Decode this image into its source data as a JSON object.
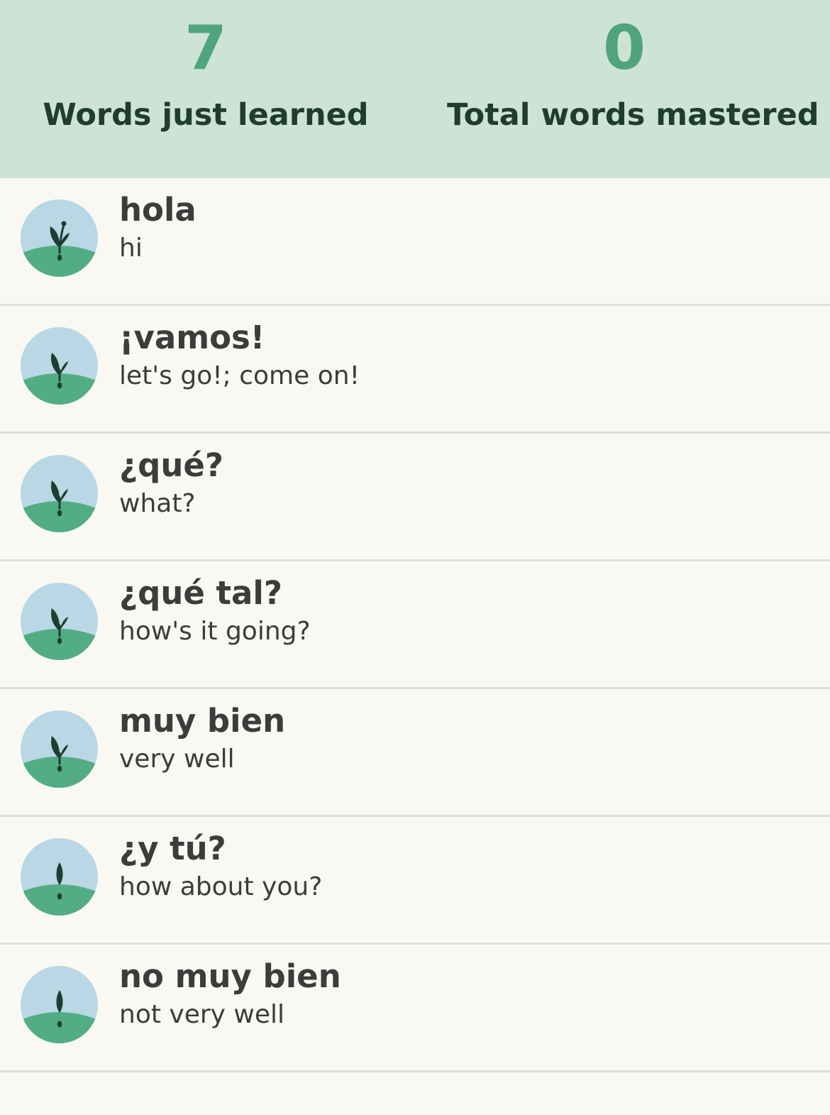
{
  "stats": {
    "learned": {
      "value": "7",
      "label": "Words just learned"
    },
    "mastered": {
      "value": "0",
      "label": "Total words mastered"
    }
  },
  "colors": {
    "header_bg": "#cde3d6",
    "accent_green": "#4fa47c",
    "sky_blue": "#b9d7e4",
    "ground_green": "#52ad84",
    "sprout_dark": "#1f3d2f"
  },
  "words": [
    {
      "term": "hola",
      "translation": "hi",
      "icon": "sprout-stage-3-icon"
    },
    {
      "term": "¡vamos!",
      "translation": "let's go!; come on!",
      "icon": "sprout-stage-2-icon"
    },
    {
      "term": "¿qué?",
      "translation": "what?",
      "icon": "sprout-stage-2-icon"
    },
    {
      "term": "¿qué tal?",
      "translation": "how's it going?",
      "icon": "sprout-stage-2-icon"
    },
    {
      "term": "muy bien",
      "translation": "very well",
      "icon": "sprout-stage-2-icon"
    },
    {
      "term": "¿y tú?",
      "translation": "how about you?",
      "icon": "sprout-stage-1-icon"
    },
    {
      "term": "no muy bien",
      "translation": "not very well",
      "icon": "sprout-stage-1-icon"
    }
  ]
}
